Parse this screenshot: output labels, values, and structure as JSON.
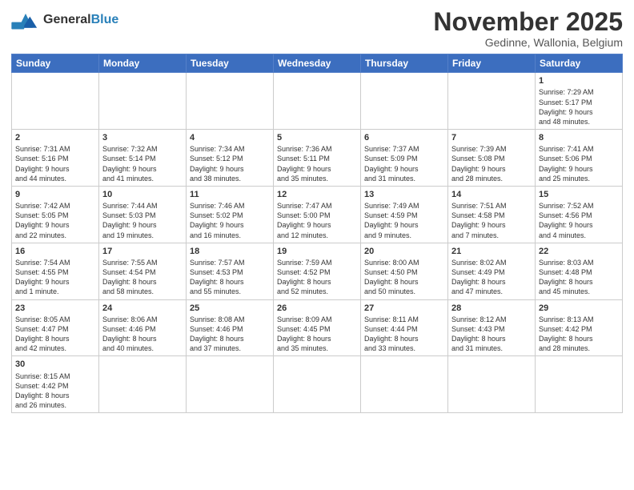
{
  "header": {
    "logo_general": "General",
    "logo_blue": "Blue",
    "month_title": "November 2025",
    "subtitle": "Gedinne, Wallonia, Belgium"
  },
  "weekdays": [
    "Sunday",
    "Monday",
    "Tuesday",
    "Wednesday",
    "Thursday",
    "Friday",
    "Saturday"
  ],
  "days": [
    {
      "num": "",
      "info": ""
    },
    {
      "num": "",
      "info": ""
    },
    {
      "num": "",
      "info": ""
    },
    {
      "num": "",
      "info": ""
    },
    {
      "num": "",
      "info": ""
    },
    {
      "num": "",
      "info": ""
    },
    {
      "num": "1",
      "info": "Sunrise: 7:29 AM\nSunset: 5:17 PM\nDaylight: 9 hours\nand 48 minutes."
    }
  ],
  "week2": [
    {
      "num": "2",
      "info": "Sunrise: 7:31 AM\nSunset: 5:16 PM\nDaylight: 9 hours\nand 44 minutes."
    },
    {
      "num": "3",
      "info": "Sunrise: 7:32 AM\nSunset: 5:14 PM\nDaylight: 9 hours\nand 41 minutes."
    },
    {
      "num": "4",
      "info": "Sunrise: 7:34 AM\nSunset: 5:12 PM\nDaylight: 9 hours\nand 38 minutes."
    },
    {
      "num": "5",
      "info": "Sunrise: 7:36 AM\nSunset: 5:11 PM\nDaylight: 9 hours\nand 35 minutes."
    },
    {
      "num": "6",
      "info": "Sunrise: 7:37 AM\nSunset: 5:09 PM\nDaylight: 9 hours\nand 31 minutes."
    },
    {
      "num": "7",
      "info": "Sunrise: 7:39 AM\nSunset: 5:08 PM\nDaylight: 9 hours\nand 28 minutes."
    },
    {
      "num": "8",
      "info": "Sunrise: 7:41 AM\nSunset: 5:06 PM\nDaylight: 9 hours\nand 25 minutes."
    }
  ],
  "week3": [
    {
      "num": "9",
      "info": "Sunrise: 7:42 AM\nSunset: 5:05 PM\nDaylight: 9 hours\nand 22 minutes."
    },
    {
      "num": "10",
      "info": "Sunrise: 7:44 AM\nSunset: 5:03 PM\nDaylight: 9 hours\nand 19 minutes."
    },
    {
      "num": "11",
      "info": "Sunrise: 7:46 AM\nSunset: 5:02 PM\nDaylight: 9 hours\nand 16 minutes."
    },
    {
      "num": "12",
      "info": "Sunrise: 7:47 AM\nSunset: 5:00 PM\nDaylight: 9 hours\nand 12 minutes."
    },
    {
      "num": "13",
      "info": "Sunrise: 7:49 AM\nSunset: 4:59 PM\nDaylight: 9 hours\nand 9 minutes."
    },
    {
      "num": "14",
      "info": "Sunrise: 7:51 AM\nSunset: 4:58 PM\nDaylight: 9 hours\nand 7 minutes."
    },
    {
      "num": "15",
      "info": "Sunrise: 7:52 AM\nSunset: 4:56 PM\nDaylight: 9 hours\nand 4 minutes."
    }
  ],
  "week4": [
    {
      "num": "16",
      "info": "Sunrise: 7:54 AM\nSunset: 4:55 PM\nDaylight: 9 hours\nand 1 minute."
    },
    {
      "num": "17",
      "info": "Sunrise: 7:55 AM\nSunset: 4:54 PM\nDaylight: 8 hours\nand 58 minutes."
    },
    {
      "num": "18",
      "info": "Sunrise: 7:57 AM\nSunset: 4:53 PM\nDaylight: 8 hours\nand 55 minutes."
    },
    {
      "num": "19",
      "info": "Sunrise: 7:59 AM\nSunset: 4:52 PM\nDaylight: 8 hours\nand 52 minutes."
    },
    {
      "num": "20",
      "info": "Sunrise: 8:00 AM\nSunset: 4:50 PM\nDaylight: 8 hours\nand 50 minutes."
    },
    {
      "num": "21",
      "info": "Sunrise: 8:02 AM\nSunset: 4:49 PM\nDaylight: 8 hours\nand 47 minutes."
    },
    {
      "num": "22",
      "info": "Sunrise: 8:03 AM\nSunset: 4:48 PM\nDaylight: 8 hours\nand 45 minutes."
    }
  ],
  "week5": [
    {
      "num": "23",
      "info": "Sunrise: 8:05 AM\nSunset: 4:47 PM\nDaylight: 8 hours\nand 42 minutes."
    },
    {
      "num": "24",
      "info": "Sunrise: 8:06 AM\nSunset: 4:46 PM\nDaylight: 8 hours\nand 40 minutes."
    },
    {
      "num": "25",
      "info": "Sunrise: 8:08 AM\nSunset: 4:46 PM\nDaylight: 8 hours\nand 37 minutes."
    },
    {
      "num": "26",
      "info": "Sunrise: 8:09 AM\nSunset: 4:45 PM\nDaylight: 8 hours\nand 35 minutes."
    },
    {
      "num": "27",
      "info": "Sunrise: 8:11 AM\nSunset: 4:44 PM\nDaylight: 8 hours\nand 33 minutes."
    },
    {
      "num": "28",
      "info": "Sunrise: 8:12 AM\nSunset: 4:43 PM\nDaylight: 8 hours\nand 31 minutes."
    },
    {
      "num": "29",
      "info": "Sunrise: 8:13 AM\nSunset: 4:42 PM\nDaylight: 8 hours\nand 28 minutes."
    }
  ],
  "week6": [
    {
      "num": "30",
      "info": "Sunrise: 8:15 AM\nSunset: 4:42 PM\nDaylight: 8 hours\nand 26 minutes."
    },
    {
      "num": "",
      "info": ""
    },
    {
      "num": "",
      "info": ""
    },
    {
      "num": "",
      "info": ""
    },
    {
      "num": "",
      "info": ""
    },
    {
      "num": "",
      "info": ""
    },
    {
      "num": "",
      "info": ""
    }
  ]
}
